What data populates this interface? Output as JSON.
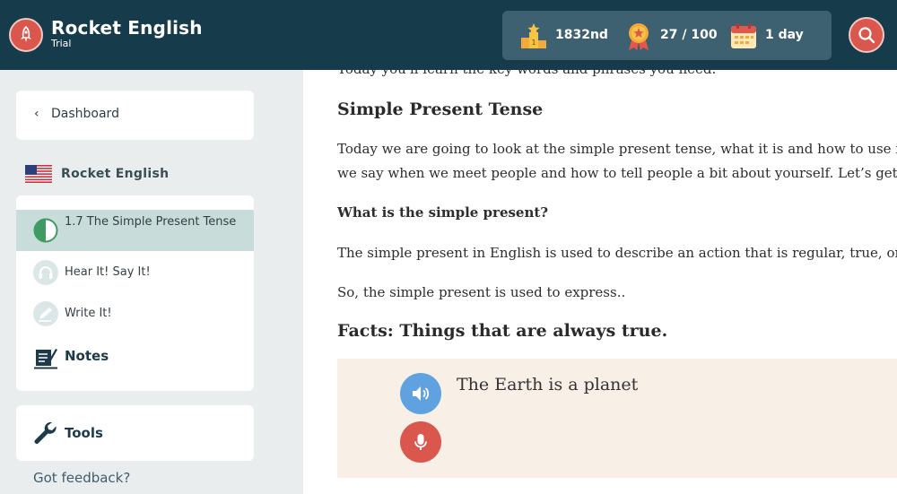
{
  "header": {
    "brand_name": "Rocket English",
    "brand_sub": "Trial",
    "stats": {
      "rank": "1832nd",
      "points": "27 / 100",
      "streak": "1 day"
    }
  },
  "sidebar": {
    "dashboard_label": "Dashboard",
    "course_title": "Rocket English",
    "lessons": [
      {
        "label": "1.7 The Simple Present Tense",
        "active": true
      },
      {
        "label": "Hear It! Say It!"
      },
      {
        "label": "Write It!"
      }
    ],
    "notes_label": "Notes",
    "tools_label": "Tools",
    "feedback_label": "Got feedback?"
  },
  "content": {
    "cut_line": "Today you'll learn the key words and phrases you need.",
    "heading": "Simple Present Tense",
    "intro_line1": "Today we are going to look at the simple present tense, what it is and how to use it",
    "intro_line2": "we say when we meet people and how to tell people a bit about yourself. Let’s get st",
    "what_is": "What is the simple present?",
    "used_for": "The simple present in English is used to describe an action that is regular, true, or",
    "so_line": "So, the simple present is used to express..",
    "facts_heading": "Facts: Things that are always true.",
    "example": "The Earth is a planet"
  },
  "colors": {
    "header_bg": "#163c4c",
    "accent_red": "#d9574c",
    "play_blue": "#5fa2df",
    "active_lesson_bg": "#c8dcd9",
    "example_bg": "#f8efe6"
  },
  "icons": [
    "rocket-icon",
    "trophy-icon",
    "medal-icon",
    "calendar-icon",
    "search-icon",
    "chevron-left-icon",
    "us-flag-icon",
    "half-circle-progress-icon",
    "headphones-icon",
    "pencil-icon",
    "notes-icon",
    "wrench-icon",
    "speaker-icon",
    "microphone-icon"
  ]
}
